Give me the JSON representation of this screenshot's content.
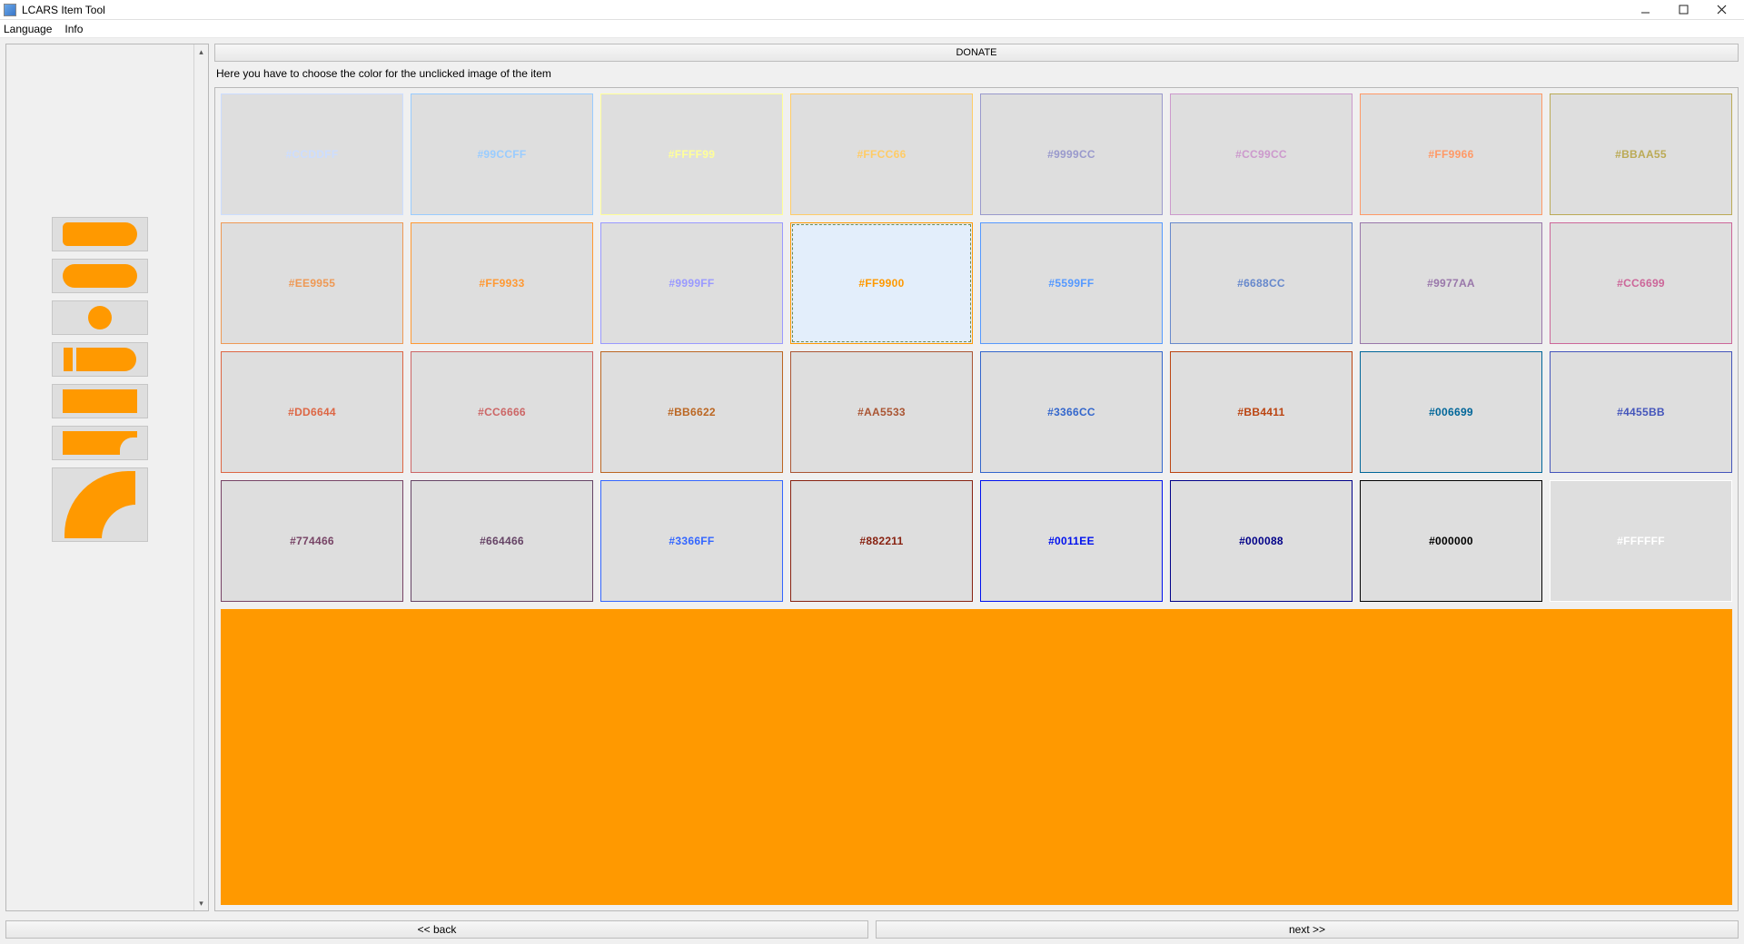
{
  "window": {
    "title": "LCARS Item Tool"
  },
  "menu": {
    "language": "Language",
    "info": "Info"
  },
  "donate_label": "DONATE",
  "instruction": "Here you have to choose the color for the unclicked image of the item",
  "nav": {
    "back": "<< back",
    "next": "next >>"
  },
  "selected_color": "#FF9900",
  "preview_color": "#FF9900",
  "colors": [
    {
      "hex": "#CCDDFF"
    },
    {
      "hex": "#99CCFF"
    },
    {
      "hex": "#FFFF99"
    },
    {
      "hex": "#FFCC66"
    },
    {
      "hex": "#9999CC"
    },
    {
      "hex": "#CC99CC"
    },
    {
      "hex": "#FF9966"
    },
    {
      "hex": "#BBAA55"
    },
    {
      "hex": "#EE9955"
    },
    {
      "hex": "#FF9933"
    },
    {
      "hex": "#9999FF"
    },
    {
      "hex": "#FF9900"
    },
    {
      "hex": "#5599FF"
    },
    {
      "hex": "#6688CC"
    },
    {
      "hex": "#9977AA"
    },
    {
      "hex": "#CC6699"
    },
    {
      "hex": "#DD6644"
    },
    {
      "hex": "#CC6666"
    },
    {
      "hex": "#BB6622"
    },
    {
      "hex": "#AA5533"
    },
    {
      "hex": "#3366CC"
    },
    {
      "hex": "#BB4411"
    },
    {
      "hex": "#006699"
    },
    {
      "hex": "#4455BB"
    },
    {
      "hex": "#774466"
    },
    {
      "hex": "#664466"
    },
    {
      "hex": "#3366FF"
    },
    {
      "hex": "#882211"
    },
    {
      "hex": "#0011EE"
    },
    {
      "hex": "#000088"
    },
    {
      "hex": "#000000"
    },
    {
      "hex": "#FFFFFF"
    }
  ]
}
